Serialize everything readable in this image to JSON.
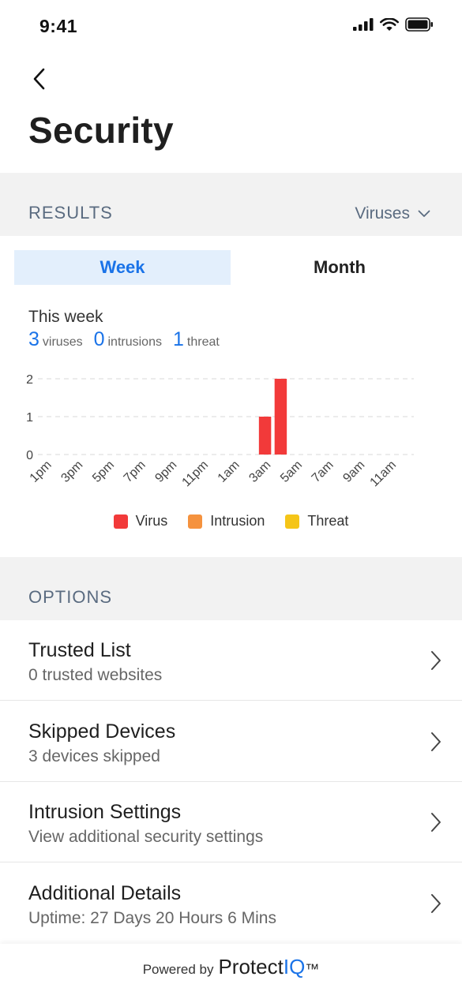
{
  "status_bar": {
    "time": "9:41"
  },
  "header": {
    "title": "Security"
  },
  "results": {
    "label": "RESULTS",
    "filter": "Viruses",
    "tabs": {
      "week": "Week",
      "month": "Month",
      "active": "week"
    },
    "period": "This week",
    "summary": {
      "viruses_count": "3",
      "viruses_label": "viruses",
      "intrusions_count": "0",
      "intrusions_label": "intrusions",
      "threat_count": "1",
      "threat_label": "threat"
    }
  },
  "chart_data": {
    "type": "bar",
    "categories": [
      "1pm",
      "2pm",
      "3pm",
      "4pm",
      "5pm",
      "6pm",
      "7pm",
      "8pm",
      "9pm",
      "10pm",
      "11pm",
      "12am",
      "1am",
      "2am",
      "3am",
      "4am",
      "5am",
      "6am",
      "7am",
      "8am",
      "9am",
      "10am",
      "11am",
      "12pm"
    ],
    "tick_labels": [
      "1pm",
      "3pm",
      "5pm",
      "7pm",
      "9pm",
      "11pm",
      "1am",
      "3am",
      "5am",
      "7am",
      "9am",
      "11am"
    ],
    "series": [
      {
        "name": "Virus",
        "color": "#f23a3a",
        "values": [
          0,
          0,
          0,
          0,
          0,
          0,
          0,
          0,
          0,
          0,
          0,
          0,
          0,
          0,
          1,
          2,
          0,
          0,
          0,
          0,
          0,
          0,
          0,
          0
        ]
      },
      {
        "name": "Intrusion",
        "color": "#f5923e",
        "values": [
          0,
          0,
          0,
          0,
          0,
          0,
          0,
          0,
          0,
          0,
          0,
          0,
          0,
          0,
          0,
          0,
          0,
          0,
          0,
          0,
          0,
          0,
          0,
          0
        ]
      },
      {
        "name": "Threat",
        "color": "#f5c518",
        "values": [
          0,
          0,
          0,
          0,
          0,
          0,
          0,
          0,
          0,
          0,
          0,
          0,
          0,
          0,
          0,
          0,
          0,
          0,
          0,
          0,
          0,
          0,
          0,
          0
        ]
      }
    ],
    "yticks": [
      0,
      1,
      2
    ],
    "ylim": [
      0,
      2
    ],
    "grid": true,
    "legend": "bottom-center"
  },
  "options": {
    "label": "OPTIONS",
    "items": [
      {
        "title": "Trusted List",
        "subtitle": "0 trusted websites"
      },
      {
        "title": "Skipped Devices",
        "subtitle": "3 devices skipped"
      },
      {
        "title": "Intrusion Settings",
        "subtitle": "View additional security settings"
      },
      {
        "title": "Additional Details",
        "subtitle": "Uptime: 27 Days 20 Hours 6 Mins"
      }
    ]
  },
  "footer": {
    "powered": "Powered by",
    "brand_a": "Protect",
    "brand_b": "IQ",
    "tm": "™"
  },
  "colors": {
    "accent": "#1a73e8",
    "virus": "#f23a3a",
    "intrusion": "#f5923e",
    "threat": "#f5c518"
  }
}
